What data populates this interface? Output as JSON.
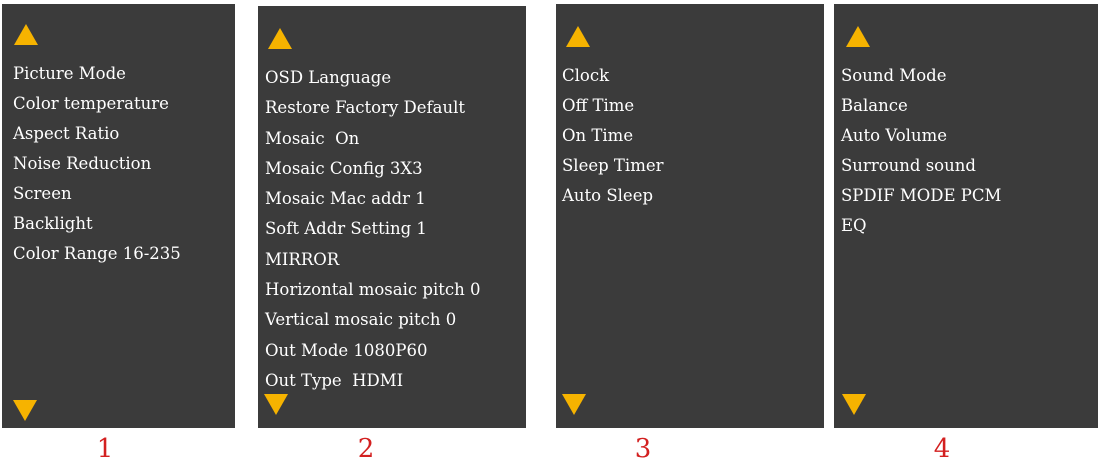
{
  "panels": [
    {
      "number": "1",
      "items": [
        "Picture Mode",
        "Color temperature",
        "Aspect Ratio",
        "Noise Reduction",
        "Screen",
        "Backlight",
        "Color Range 16-235"
      ]
    },
    {
      "number": "2",
      "items": [
        "OSD Language",
        "Restore Factory Default",
        "Mosaic  On",
        "Mosaic Config 3X3",
        "Mosaic Mac addr 1",
        "Soft Addr Setting 1",
        "MIRROR",
        "Horizontal mosaic pitch 0",
        "Vertical mosaic pitch 0",
        "Out Mode 1080P60",
        "Out Type  HDMI"
      ]
    },
    {
      "number": "3",
      "items": [
        "Clock",
        "Off Time",
        "On Time",
        "Sleep Timer",
        "Auto Sleep"
      ]
    },
    {
      "number": "4",
      "items": [
        "Sound Mode",
        "Balance",
        "Auto Volume",
        "Surround sound",
        "SPDIF MODE PCM",
        "EQ"
      ]
    }
  ],
  "colors": {
    "panel_background": "#3b3b3b",
    "arrow": "#f6b300",
    "menu_text": "#ffffff",
    "panel_number": "#d32020"
  },
  "icons": {
    "scroll_up": "triangle-up-icon",
    "scroll_down": "triangle-down-icon"
  }
}
